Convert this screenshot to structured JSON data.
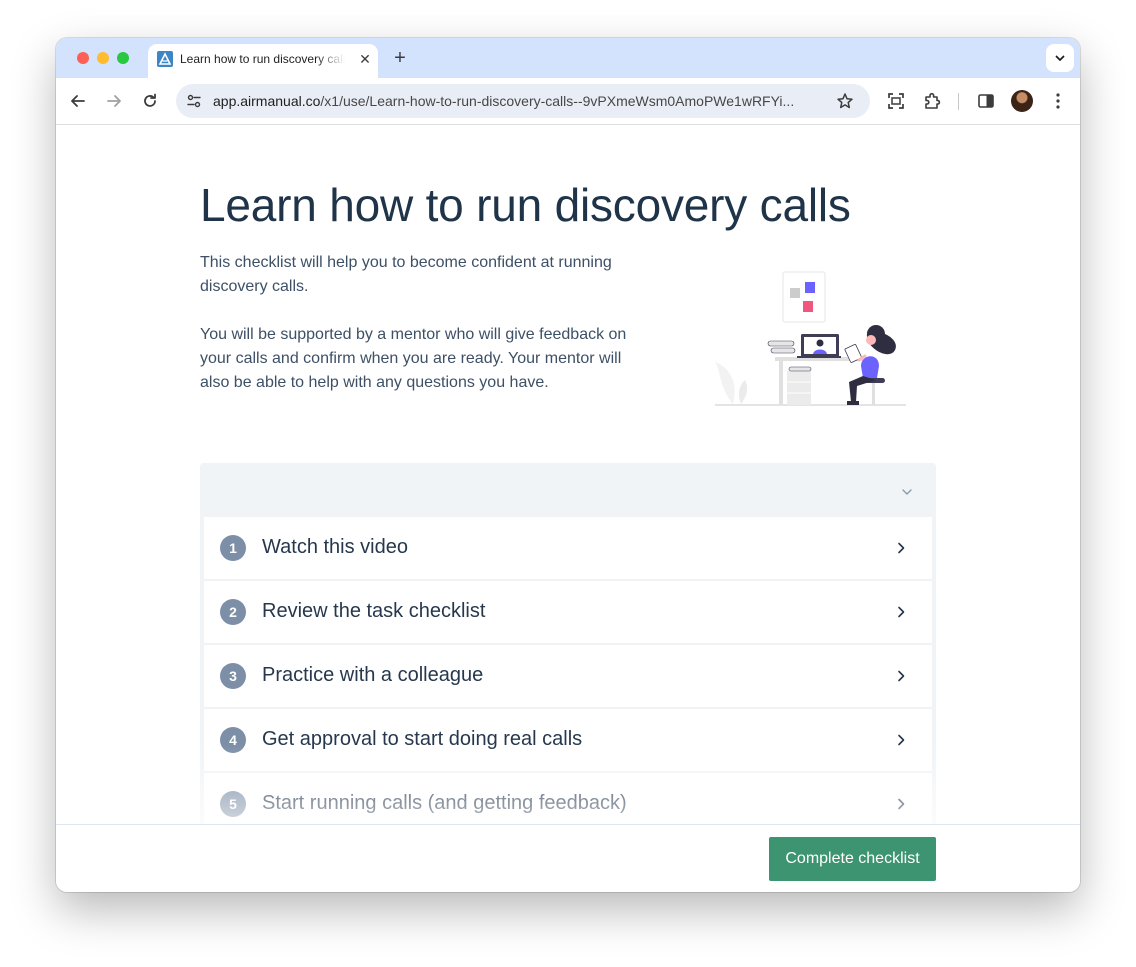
{
  "browser": {
    "tab_title": "Learn how to run discovery calls",
    "url_host": "app.airmanual.co",
    "url_path": "/x1/use/Learn-how-to-run-discovery-calls--9vPXmeWsm0AmoPWe1wRFYi...",
    "icons": {
      "favicon": "airmanual-logo-icon",
      "close": "close-icon",
      "new_tab": "plus-icon",
      "tab_search": "chevron-down-icon",
      "back": "arrow-left-icon",
      "forward": "arrow-right-icon",
      "reload": "reload-icon",
      "site_info": "tune-icon",
      "bookmark": "star-icon",
      "screenshot": "screenshot-icon",
      "extensions": "puzzle-icon",
      "side_panel": "side-panel-icon",
      "menu": "kebab-menu-icon"
    },
    "close_glyph": "✕",
    "new_tab_glyph": "+"
  },
  "page": {
    "title": "Learn how to run discovery calls",
    "intro_paragraphs": [
      "This checklist will help you to become confident at running discovery calls.",
      "You will be supported by a mentor who will give feedback on your calls and confirm when you are ready. Your mentor will also be able to help with any questions you have."
    ],
    "illustration": "person-at-desk-video-call-illustration"
  },
  "checklist": {
    "steps": [
      {
        "number": "1",
        "label": "Watch this video"
      },
      {
        "number": "2",
        "label": "Review the task checklist"
      },
      {
        "number": "3",
        "label": "Practice with a colleague"
      },
      {
        "number": "4",
        "label": "Get approval to start doing real calls"
      },
      {
        "number": "5",
        "label": "Start running calls (and getting feedback)"
      }
    ]
  },
  "footer": {
    "complete_label": "Complete checklist"
  },
  "colors": {
    "title": "#1f3349",
    "body_text": "#3d5066",
    "step_badge": "#7c8fa7",
    "checklist_bg": "#f1f4f7",
    "primary_button": "#3d9470",
    "tab_strip": "#d3e3fd",
    "omnibox": "#e9eef6",
    "illustration_accent": "#6c63ff",
    "illustration_pink": "#f0577e"
  }
}
